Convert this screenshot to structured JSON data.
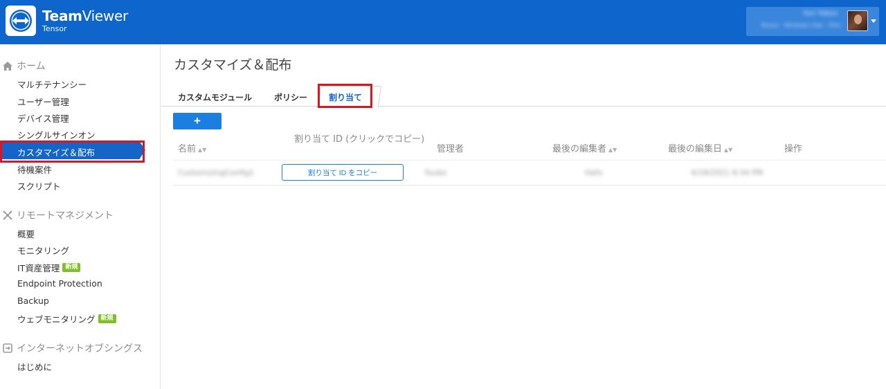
{
  "app": {
    "brand_bold": "Team",
    "brand_rest": "Viewer",
    "product": "Tensor"
  },
  "user": {
    "name": "Yuri Yokoo",
    "org": "Tensor - Windows User - Pink"
  },
  "sidebar": {
    "home": {
      "title": "ホーム",
      "items": [
        "マルチテナンシー",
        "ユーザー管理",
        "デバイス管理",
        "シングルサインオン",
        "カスタマイズ＆配布",
        "待機案件",
        "スクリプト"
      ]
    },
    "remote": {
      "title": "リモートマネジメント",
      "items": [
        "概要",
        "モニタリング",
        "IT資産管理",
        "Endpoint Protection",
        "Backup",
        "ウェブモニタリング"
      ],
      "new_badge": "新規"
    },
    "iot": {
      "title": "インターネットオブシングス",
      "items": [
        "はじめに"
      ]
    }
  },
  "main": {
    "title": "カスタマイズ＆配布",
    "tabs": [
      "カスタムモジュール",
      "ポリシー",
      "割り当て"
    ],
    "add_label": "+",
    "columns": [
      "名前",
      "割り当て ID (クリックでコピー)",
      "管理者",
      "最後の編集者",
      "最後の編集日",
      "操作"
    ],
    "rows": [
      {
        "name": "CustomizingConfig1",
        "copy_label": "割り当て ID をコピー",
        "admin": "Yuuko",
        "editor": "Hafo",
        "edited": "4/18/2021 8:34 PM"
      }
    ]
  },
  "colors": {
    "header_blue": "#0e66cc",
    "active_blue": "#1565c8",
    "highlight_red": "#e0141d",
    "badge_green": "#7fbf27"
  }
}
